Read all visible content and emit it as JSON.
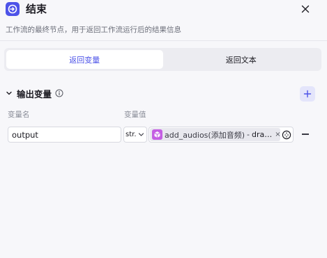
{
  "node": {
    "title": "结束",
    "description": "工作流的最终节点，用于返回工作流运行后的结果信息",
    "icon": "exit-icon",
    "accent_color": "#4d53e8"
  },
  "tabs": [
    {
      "label": "返回变量",
      "active": true
    },
    {
      "label": "返回文本",
      "active": false
    }
  ],
  "output_section": {
    "title": "输出变量",
    "columns": {
      "name": "变量名",
      "value": "变量值"
    },
    "rows": [
      {
        "name": "output",
        "type": "str.",
        "ref_node": "add_audios(添加音频)",
        "ref_separator": "-",
        "ref_field": "dra…",
        "ref_close": "×"
      }
    ]
  },
  "colors": {
    "plugin_icon": "#c45ee3",
    "tab_active_text": "#4d53e8",
    "add_button_bg": "#e4e5fb"
  }
}
